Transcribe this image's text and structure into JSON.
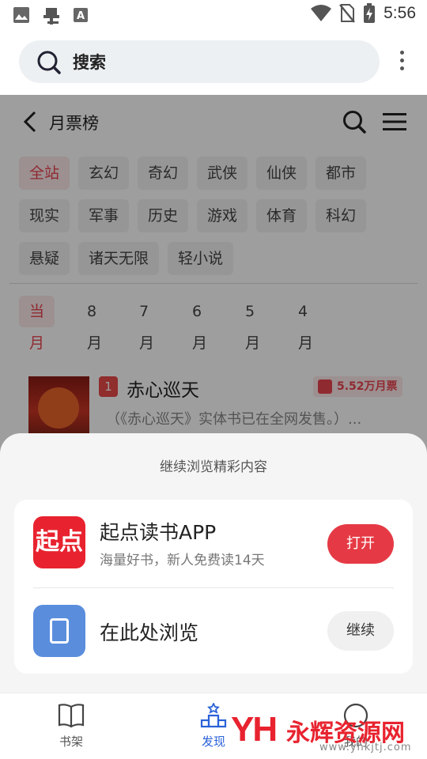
{
  "status_bar": {
    "time": "5:56",
    "left_icons": [
      "image-icon",
      "bug-icon",
      "font-a-icon"
    ],
    "right_icons": [
      "wifi-icon",
      "no-sim-icon",
      "battery-charging-icon"
    ]
  },
  "browser": {
    "search_label": "搜索"
  },
  "page": {
    "title": "月票榜",
    "categories": [
      "全站",
      "玄幻",
      "奇幻",
      "武侠",
      "仙侠",
      "都市",
      "现实",
      "军事",
      "历史",
      "游戏",
      "体育",
      "科幻",
      "悬疑",
      "诸天无限",
      "轻小说"
    ],
    "active_category": "全站",
    "months": [
      "当月",
      "8月",
      "7月",
      "6月",
      "5月",
      "4月"
    ],
    "active_month": "当月",
    "book": {
      "rank": "1",
      "title": "赤心巡天",
      "tickets": "5.52万月票",
      "desc": "（《赤心巡天》实体书已在全网发售。）..."
    }
  },
  "sheet": {
    "title": "继续浏览精彩内容",
    "app_option": {
      "icon_text": "起点",
      "name": "起点读书APP",
      "subtitle": "海量好书，新人免费读14天",
      "button": "打开"
    },
    "browse_option": {
      "name": "在此处浏览",
      "button": "继续"
    }
  },
  "bottom_nav": [
    {
      "label": "书架",
      "icon": "book-open-icon",
      "active": false
    },
    {
      "label": "发现",
      "icon": "discover-podium-icon",
      "active": true
    },
    {
      "label": "我的",
      "icon": "profile-icon",
      "active": false
    }
  ],
  "watermark": {
    "logo": "YH",
    "text": "永辉资源网",
    "url": "www.yhkjtj.com"
  },
  "colors": {
    "accent_red": "#e53a45",
    "accent_blue": "#2a62d8",
    "sheet_bg": "#f5f5f5"
  }
}
